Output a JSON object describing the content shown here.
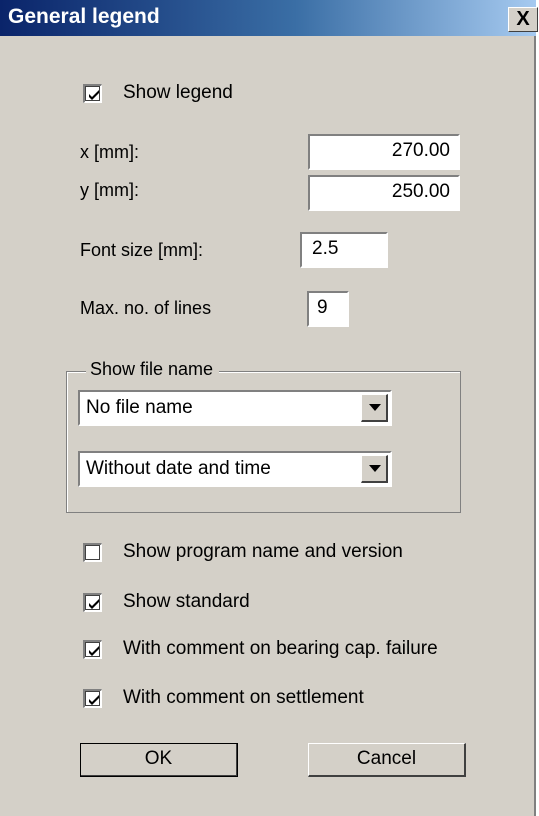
{
  "window": {
    "title": "General legend",
    "close_glyph": "X"
  },
  "show_legend": {
    "label": "Show legend",
    "checked": true
  },
  "fields": {
    "x_label": "x [mm]:",
    "x_value": "270.00",
    "y_label": "y [mm]:",
    "y_value": "250.00",
    "font_label": "Font size [mm]:",
    "font_value": "2.5",
    "lines_label": "Max. no. of lines",
    "lines_value": "9"
  },
  "file_name_group": {
    "label": "Show file name",
    "file_select": "No file name",
    "date_select": "Without date and time"
  },
  "options": {
    "program": {
      "label": "Show program name and version",
      "checked": false
    },
    "standard": {
      "label": "Show standard",
      "checked": true
    },
    "bearing": {
      "label": "With comment on bearing cap. failure",
      "checked": true
    },
    "settlement": {
      "label": "With comment on settlement",
      "checked": true
    }
  },
  "buttons": {
    "ok": "OK",
    "cancel": "Cancel"
  }
}
